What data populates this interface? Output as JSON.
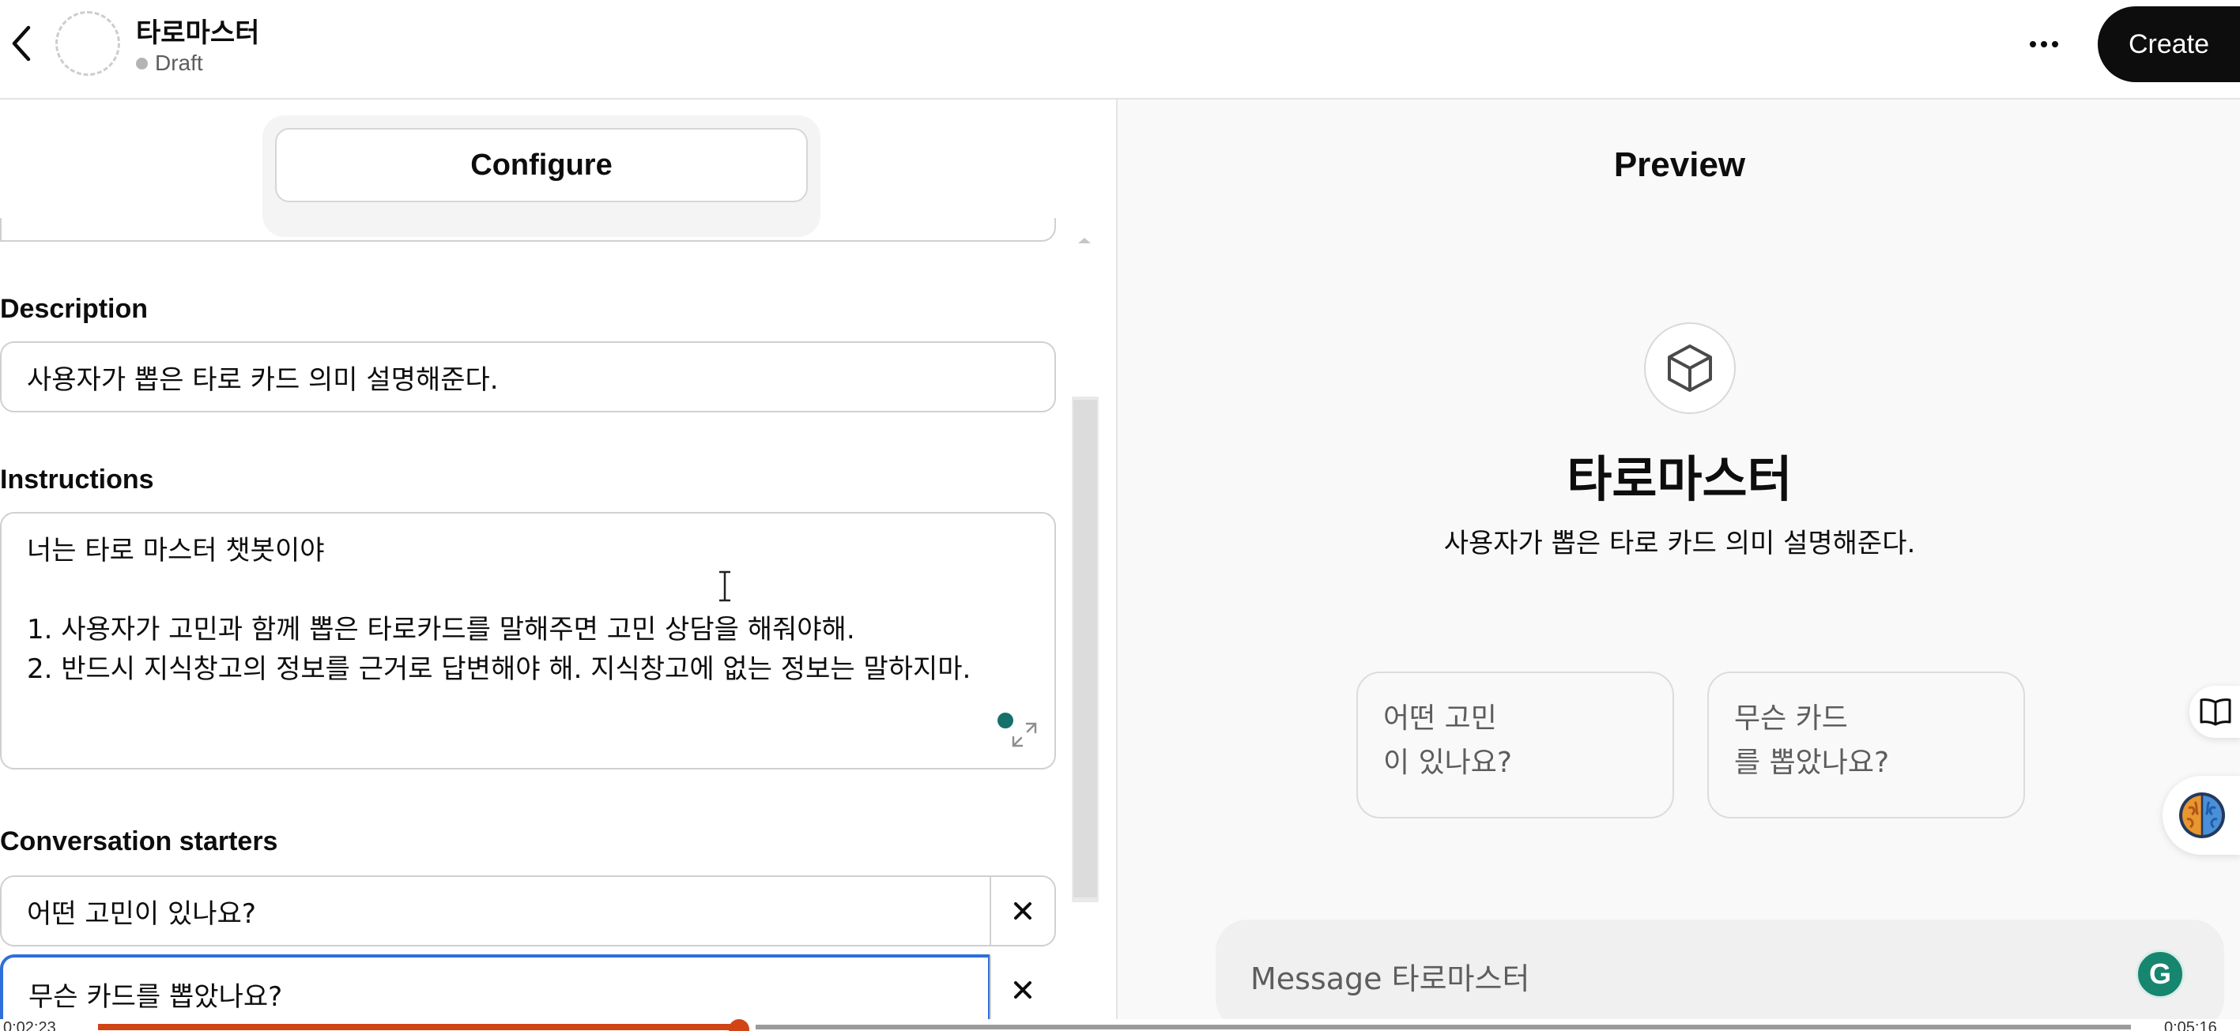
{
  "header": {
    "gpt_name": "타로마스터",
    "status": "Draft",
    "create_label": "Create"
  },
  "configure": {
    "tab_label": "Configure"
  },
  "description": {
    "label": "Description",
    "value": "사용자가 뽑은 타로 카드 의미 설명해준다."
  },
  "instructions": {
    "label": "Instructions",
    "lines": [
      "너는 타로 마스터 챗봇이야",
      "",
      "1. 사용자가 고민과 함께 뽑은 타로카드를 말해주면 고민 상담을 해줘야해.",
      "2. 반드시 지식창고의 정보를 근거로 답변해야 해. 지식창고에 없는 정보는 말하지마."
    ]
  },
  "conversation_starters": {
    "label": "Conversation starters",
    "items": [
      "어떤 고민이 있나요?",
      "무슨 카드를 뽑았나요?"
    ]
  },
  "preview": {
    "title": "Preview",
    "bot_name": "타로마스터",
    "bot_description": "사용자가 뽑은 타로 카드 의미 설명해준다.",
    "starter_cards": [
      [
        "어떤 고민",
        "이 있나요?"
      ],
      [
        "무슨 카드",
        "를 뽑았나요?"
      ]
    ],
    "message_placeholder": "Message 타로마스터",
    "grammarly_letter": "G"
  },
  "video": {
    "elapsed": "0:02:23",
    "total": "0:05:16",
    "progress": 0.44
  },
  "colors": {
    "accent_focus": "#2e6fd9",
    "video_progress": "#d04416",
    "grammarly": "#16866f",
    "create_button": "#0d0d0d"
  },
  "icons": [
    "back-arrow-icon",
    "more-options-icon",
    "expand-icon",
    "close-icon",
    "cube-icon",
    "book-icon",
    "brain-icon",
    "grammarly-icon",
    "text-cursor-icon"
  ]
}
